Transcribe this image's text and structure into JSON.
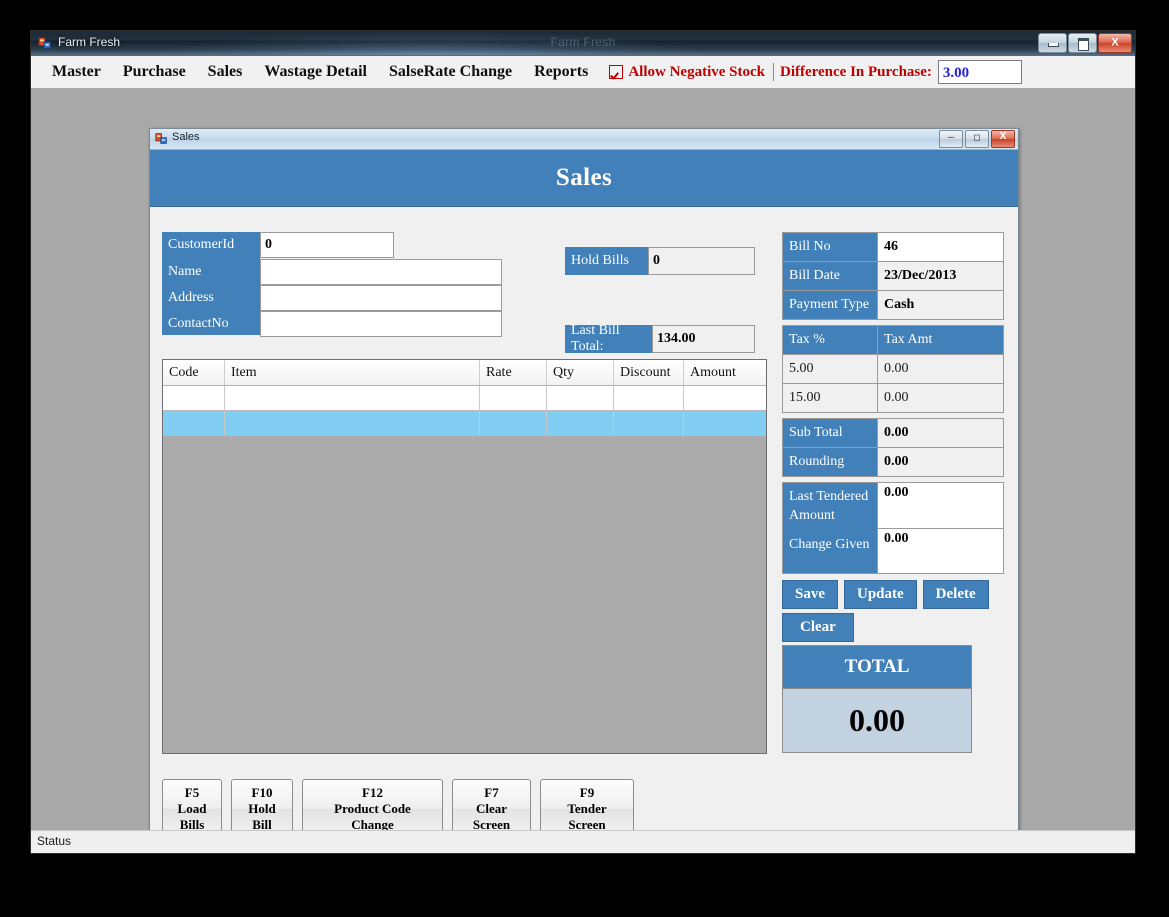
{
  "app": {
    "title": "Farm Fresh",
    "ghost_title": "Farm Fresh",
    "icon": "app-form-icon",
    "window_controls": {
      "minimize": "minimize-icon",
      "maximize": "maximize-icon",
      "close": "X"
    }
  },
  "menu": {
    "items": [
      {
        "label": "Master"
      },
      {
        "label": "Purchase"
      },
      {
        "label": "Sales"
      },
      {
        "label": "Wastage Detail"
      },
      {
        "label": "SalseRate Change"
      },
      {
        "label": "Reports"
      }
    ],
    "allow_negative_stock": {
      "label": "Allow Negative Stock",
      "checked": true
    },
    "difference_in_purchase": {
      "label": "Difference In Purchase:",
      "value": "3.00",
      "value_color": "#2222dd"
    },
    "label_color": "#c00000"
  },
  "child_window": {
    "titlebar_text": "Sales",
    "icon": "form-icon",
    "controls": {
      "minimize": "minimize-icon",
      "maximize": "maximize-icon",
      "close": "X"
    },
    "heading": "Sales"
  },
  "customer": {
    "rows": [
      {
        "label": "CustomerId",
        "value": "0"
      },
      {
        "label": "Name",
        "value": ""
      },
      {
        "label": "Address",
        "value": ""
      },
      {
        "label": "ContactNo",
        "value": ""
      }
    ]
  },
  "hold_bills": {
    "label": "Hold Bills",
    "value": "0"
  },
  "last_bill_total": {
    "label": "Last Bill Total:",
    "value": "134.00"
  },
  "grid": {
    "columns": [
      "Code",
      "Item",
      "Rate",
      "Qty",
      "Discount",
      "Amount"
    ],
    "rows": [
      {
        "selected": false,
        "cells": [
          "",
          "",
          "",
          "",
          "",
          ""
        ]
      },
      {
        "selected": true,
        "cells": [
          "",
          "",
          "",
          "",
          "",
          ""
        ]
      }
    ]
  },
  "function_buttons": [
    {
      "key": "F5",
      "text": "Load Bills"
    },
    {
      "key": "F10",
      "text": "Hold Bill"
    },
    {
      "key": "F12",
      "text": "Product Code Change"
    },
    {
      "key": "F7",
      "text": "Clear Screen"
    },
    {
      "key": "F9",
      "text": "Tender Screen"
    }
  ],
  "bill_info": [
    {
      "label": "Bill No",
      "value": "46"
    },
    {
      "label": "Bill Date",
      "value": "23/Dec/2013"
    },
    {
      "label": "Payment Type",
      "value": "Cash"
    }
  ],
  "tax_table": {
    "headers": [
      "Tax %",
      "Tax Amt"
    ],
    "rows": [
      {
        "percent": "5.00",
        "amount": "0.00"
      },
      {
        "percent": "15.00",
        "amount": "0.00"
      }
    ]
  },
  "totals": [
    {
      "label": "Sub Total",
      "value": "0.00"
    },
    {
      "label": "Rounding",
      "value": "0.00"
    }
  ],
  "tender": {
    "last_tendered_label": "Last Tendered Amount",
    "last_tendered_value": "0.00",
    "change_given_label": "Change Given",
    "change_given_value": "0.00"
  },
  "actions": {
    "save": "Save",
    "update": "Update",
    "delete": "Delete",
    "clear": "Clear"
  },
  "total_box": {
    "title": "TOTAL",
    "value": "0.00"
  },
  "status_bar": {
    "text": "Status"
  },
  "colors": {
    "accent_blue": "#4180b8",
    "grid_selection": "#82cdf2",
    "mdi_background": "#a9a9a9",
    "form_background": "#f0f0f0",
    "total_value_bg": "#c3d2e0"
  }
}
